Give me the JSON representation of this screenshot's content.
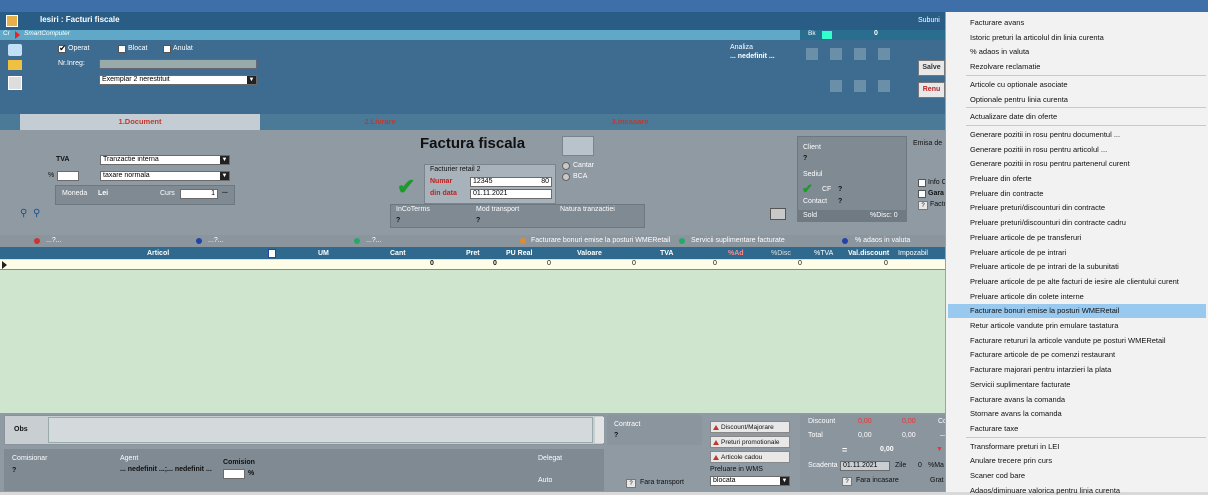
{
  "window": {
    "title": "Iesiri : Facturi fiscale",
    "top_right": "Subuni",
    "company": "SmartComputer",
    "right_count": "0",
    "ck_prefix": "Cr",
    "bk_prefix": "Bk"
  },
  "header": {
    "operat_label": "Operat",
    "operat_checked": true,
    "blocat_label": "Blocat",
    "anulat_label": "Anulat",
    "nr_inreg_label": "Nr.Inreg:",
    "exemplar_value": "Exemplar 2 nerestituit",
    "analiza_label": "Analiza",
    "analiza_value": "... nedefinit ...",
    "salve_label": "Salve",
    "renu_label": "Renu"
  },
  "tabs": [
    "1.Document",
    "2.Livrare",
    "3.Incasare"
  ],
  "document": {
    "tva_label": "TVA",
    "tva_value": "Tranzactie interna",
    "pct_label": "%",
    "taxare_value": "taxare normala",
    "moneda_label": "Moneda",
    "moneda_value": "Lei",
    "curs_label": "Curs",
    "curs_value": "1",
    "doc_title": "Factura fiscala",
    "facturier": "Facturier retail 2",
    "numar_label": "Numar",
    "numar_value": "12345",
    "numar_extra": "80",
    "data_label": "din data",
    "data_value": "01.11.2021",
    "cantar_label": "Cantar",
    "bca_label": "BCA",
    "incoterms_label": "InCoTerms",
    "incoterms_value": "?",
    "mod_transport_label": "Mod transport",
    "mod_transport_value": "?",
    "natura_label": "Natura tranzactiei",
    "client_label": "Client",
    "client_value": "?",
    "sediul_label": "Sediul",
    "cf_label": "CF",
    "cf_value": "?",
    "contact_label": "Contact",
    "contact_value": "?",
    "sold_label": "Sold",
    "disc_label": "%Disc: 0",
    "emisa_label": "Emisa de",
    "info_label": "Info C",
    "gara_label": "Gara",
    "factu_label": "Factu",
    "factu_q": "?"
  },
  "grid_toolbar": {
    "item1": "...?...",
    "item2": "...?...",
    "item3": "...?...",
    "item4": "Facturare bonuri emise la posturi WMERetail",
    "item5": "Servicii suplimentare facturate",
    "item6": "% adaos in valuta"
  },
  "grid": {
    "columns": [
      "Articol",
      "UM",
      "Cant",
      "Pret",
      "PU Real",
      "Valoare",
      "TVA",
      "%Ad",
      "%Disc",
      "%TVA",
      "Val.discount",
      "Impozabil"
    ],
    "row": [
      "",
      "",
      "0",
      "0",
      "0",
      "0",
      "0",
      "",
      "",
      "0",
      "0",
      ""
    ]
  },
  "bottom": {
    "obs_label": "Obs",
    "contract_label": "Contract",
    "contract_value": "?",
    "comisionar_label": "Comisionar",
    "comisionar_value": "?",
    "agent_label": "Agent",
    "agent_value": "... nedefinit ...;... nedefinit ...",
    "comision_label": "Comision",
    "comision_unit": "%",
    "delegat_label": "Delegat",
    "auto_label": "Auto",
    "fara_transport": "Fara transport",
    "fara_transport_q": "?",
    "discount_btn": "Discount/Majorare",
    "preturi_btn": "Preturi promotionale",
    "cadou_btn": "Articole cadou",
    "preluare_wms_label": "Preluare in WMS",
    "preluare_wms_value": "blocata",
    "discount_label": "Discount",
    "discount_v1": "0,00",
    "discount_v2": "0,00",
    "total_label": "Total",
    "total_v1": "0,00",
    "total_v2": "0,00",
    "eq_label": "=",
    "eq_value": "0,00",
    "scadenta_label": "Scadenta",
    "scadenta_value": "01.11.2021",
    "zile_label": "Zile",
    "zile_value": "0",
    "pct_ma_label": "%Ma",
    "fara_incasare": "Fara incasare",
    "fara_incasare_q": "?",
    "grat_label": "Grat",
    "co_label": "Co"
  },
  "context_menu": [
    "Facturare avans",
    "Istoric preturi la articolul din linia curenta",
    "% adaos in valuta",
    "Rezolvare reclamatie",
    "Articole cu optionale asociate",
    "Optionale pentru linia curenta",
    "Actualizare date din oferte",
    "Generare pozitii in rosu pentru documentul ...",
    "Generare pozitii in rosu pentru articolul ...",
    "Generare pozitii in rosu pentru partenerul curent",
    "Preluare din oferte",
    "Preluare din contracte",
    "Preluare preturi/discounturi din contracte",
    "Preluare preturi/discounturi din contracte cadru",
    "Preluare articole de pe transferuri",
    "Preluare articole de pe intrari",
    "Preluare articole de pe intrari de la subunitati",
    "Preluare articole de pe alte facturi de iesire ale clientului curent",
    "Preluare articole din colete interne",
    "Facturare bonuri emise la posturi  WMERetail",
    "Retur articole vandute prin emulare tastatura",
    "Facturare retururi la articole vandute pe posturi WMERetail",
    "Facturare articole de pe comenzi restaurant",
    "Facturare majorari pentru intarzieri la plata",
    "Servicii suplimentare facturate",
    "Facturare avans la comanda",
    "Stornare avans la comanda",
    "Facturare taxe",
    "Transformare preturi in LEI",
    "Anulare trecere prin curs",
    "Scaner cod bare",
    "Adaos/diminuare valorica pentru linia curenta"
  ],
  "menu_highlight_index": 19
}
